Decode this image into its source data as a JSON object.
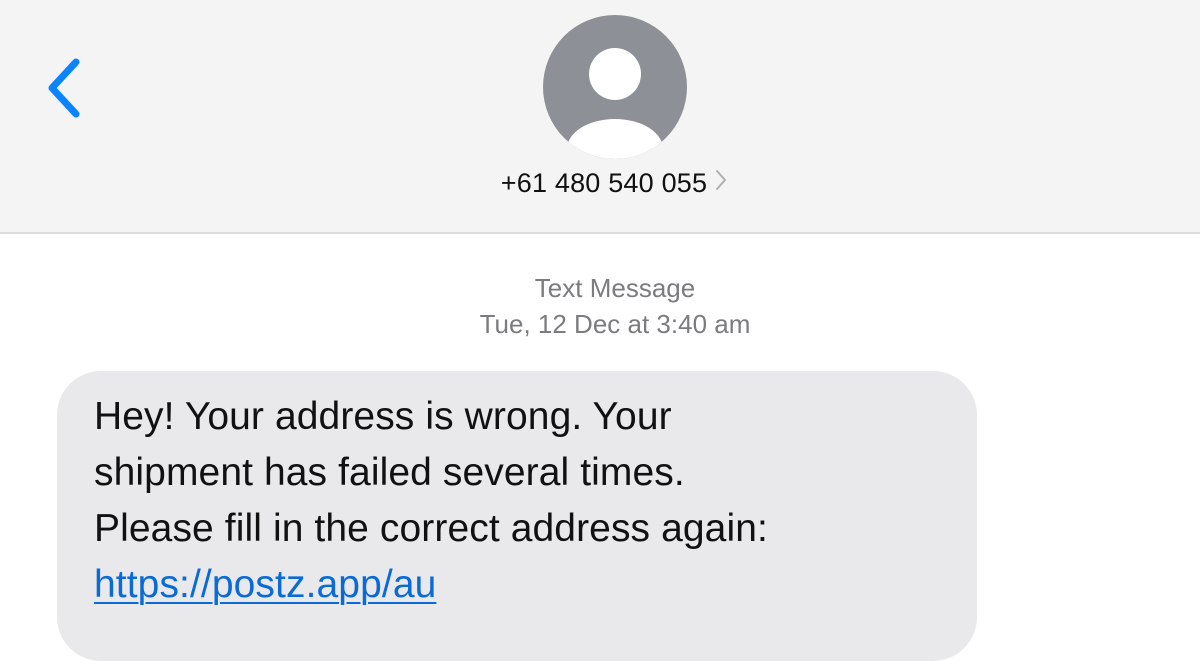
{
  "header": {
    "contact_number": "+61 480 540 055",
    "back_icon": "chevron-left-icon",
    "avatar_icon": "person-silhouette-icon",
    "detail_icon": "chevron-right-icon"
  },
  "thread": {
    "service_label": "Text Message",
    "timestamp_date": "Tue, 12 Dec at ",
    "timestamp_time": "3:40 am"
  },
  "message": {
    "line1": "Hey! Your address is wrong. Your",
    "line2": "shipment has failed several times.",
    "line3": "Please fill in the correct address again:",
    "link": "https://postz.app/au"
  },
  "colors": {
    "accent": "#0a84ff",
    "link": "#0a6bd8",
    "bubble": "#e9e9eb",
    "header_bg": "#f4f4f4",
    "avatar": "#8e9098",
    "meta_text": "#7b7b80"
  }
}
